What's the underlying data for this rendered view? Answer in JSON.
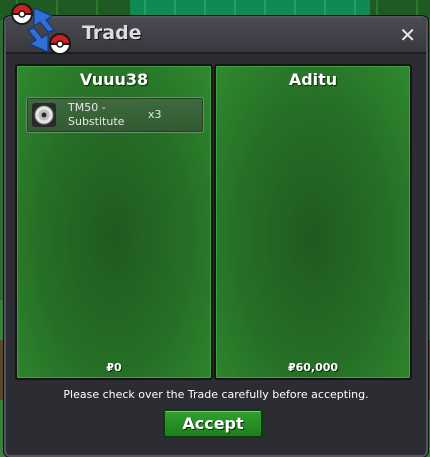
{
  "window": {
    "title": "Trade",
    "close_glyph": "✕"
  },
  "left_panel": {
    "player": "Vuuu38",
    "items": [
      {
        "name": "TM50 - Substitute",
        "quantity": "x3",
        "icon": "tm-disc-icon"
      }
    ],
    "money": "₽0"
  },
  "right_panel": {
    "player": "Aditu",
    "items": [],
    "money": "₽60,000"
  },
  "footer": {
    "notice": "Please check over the Trade carefully before accepting.",
    "accept_label": "Accept"
  },
  "colors": {
    "panel_green": "#266f26",
    "window_bg": "#2c2c33",
    "accept_green": "#1c7f1c"
  }
}
